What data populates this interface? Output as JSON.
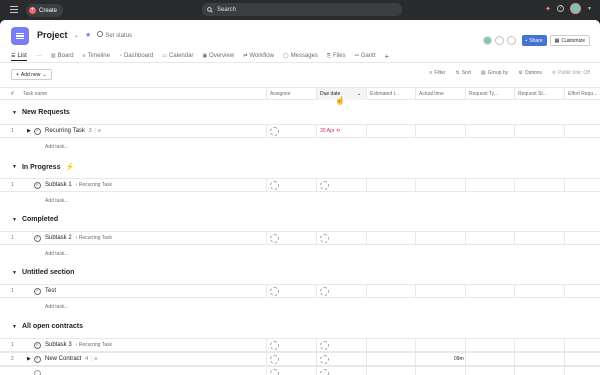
{
  "topbar": {
    "create_label": "Create",
    "search_placeholder": "Search"
  },
  "project": {
    "title": "Project",
    "set_status_label": "Set status",
    "share_label": "Share",
    "customize_label": "Customize"
  },
  "tabs": [
    {
      "label": "List",
      "icon": "list-icon"
    },
    {
      "label": "Board",
      "icon": "board-icon"
    },
    {
      "label": "Timeline",
      "icon": "timeline-icon"
    },
    {
      "label": "Dashboard",
      "icon": "dashboard-icon"
    },
    {
      "label": "Calendar",
      "icon": "calendar-icon"
    },
    {
      "label": "Overview",
      "icon": "overview-icon"
    },
    {
      "label": "Workflow",
      "icon": "workflow-icon"
    },
    {
      "label": "Messages",
      "icon": "messages-icon"
    },
    {
      "label": "Files",
      "icon": "files-icon"
    },
    {
      "label": "Gantt",
      "icon": "gantt-icon"
    }
  ],
  "toolbar": {
    "add_new_label": "Add new",
    "filter_label": "Filter",
    "sort_label": "Sort",
    "group_by_label": "Group by",
    "options_label": "Options",
    "public_link_label": "Public link: Off"
  },
  "columns": {
    "num": "#",
    "task_name": "Task name",
    "assignee": "Assignee",
    "due_date": "Due date",
    "estimated": "Estimated t...",
    "actual": "Actual time",
    "request_type": "Request Ty...",
    "request_status": "Request St...",
    "effort": "Effort Requ..."
  },
  "sections": [
    {
      "title": "New Requests"
    },
    {
      "title": "In Progress"
    },
    {
      "title": "Completed"
    },
    {
      "title": "Untitled section"
    },
    {
      "title": "All open contracts"
    }
  ],
  "tasks": {
    "t1": {
      "num": "1",
      "name": "Recurring Task",
      "subtasks": "3",
      "due": "30 Apr"
    },
    "t2": {
      "num": "1",
      "name": "Subtask 1",
      "parent": "‹ Recurring Task"
    },
    "t3": {
      "num": "1",
      "name": "Subtask 2",
      "parent": "‹ Recurring Task"
    },
    "t4": {
      "num": "1",
      "name": "Test"
    },
    "t5": {
      "num": "1",
      "name": "Subtask 3",
      "parent": "‹ Recurring Task"
    },
    "t6": {
      "num": "2",
      "name": "New Contract",
      "subtasks": "4",
      "actual": "09m"
    }
  },
  "add_task_label": "Add task..."
}
